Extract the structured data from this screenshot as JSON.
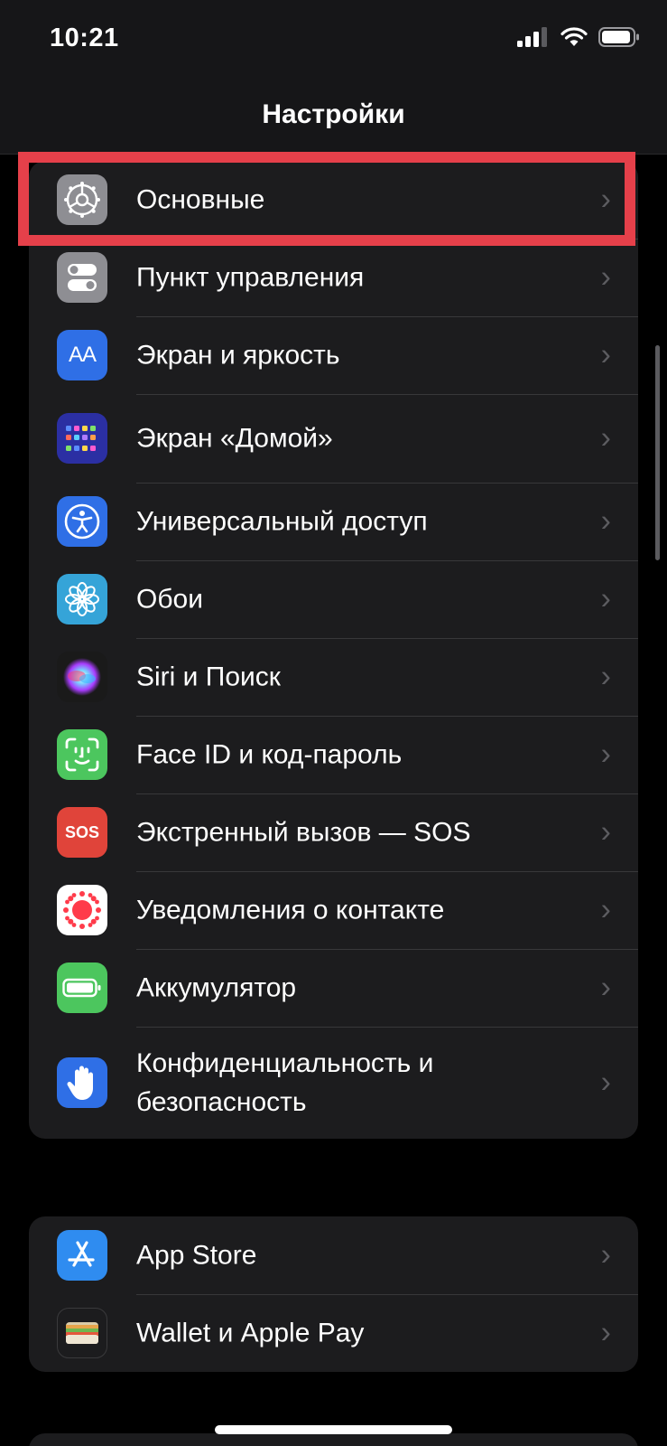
{
  "status": {
    "time": "10:21"
  },
  "header": {
    "title": "Настройки"
  },
  "groups": [
    {
      "items": [
        {
          "label": "Основные",
          "icon": "gear-icon",
          "color": "#8e8e93"
        },
        {
          "label": "Пункт управления",
          "icon": "toggles-icon",
          "color": "#8e8e93"
        },
        {
          "label": "Экран и яркость",
          "icon": "text-size-icon",
          "color": "#2f6fe6",
          "glyph": "AA"
        },
        {
          "label": "Экран «Домой»",
          "icon": "home-grid-icon",
          "color": "#2b2fa3"
        },
        {
          "label": "Универсальный доступ",
          "icon": "accessibility-icon",
          "color": "#2f6fe6"
        },
        {
          "label": "Обои",
          "icon": "flower-icon",
          "color": "#35a4d8"
        },
        {
          "label": "Siri и Поиск",
          "icon": "siri-icon",
          "color": "#1a1a1a"
        },
        {
          "label": "Face ID и код-пароль",
          "icon": "faceid-icon",
          "color": "#4cc65e"
        },
        {
          "label": "Экстренный вызов — SOS",
          "icon": "sos-icon",
          "color": "#e0443a",
          "glyph": "SOS"
        },
        {
          "label": "Уведомления о контакте",
          "icon": "exposure-icon",
          "color": "#ffffff"
        },
        {
          "label": "Аккумулятор",
          "icon": "battery-icon",
          "color": "#4cc65e"
        },
        {
          "label": "Конфиденциальность и безопасность",
          "icon": "hand-icon",
          "color": "#2f6fe6"
        }
      ]
    },
    {
      "items": [
        {
          "label": "App Store",
          "icon": "app-store-icon",
          "color": "#2f8cf0"
        },
        {
          "label": "Wallet и Apple Pay",
          "icon": "wallet-icon",
          "color": "#1c1c1e"
        }
      ]
    }
  ]
}
